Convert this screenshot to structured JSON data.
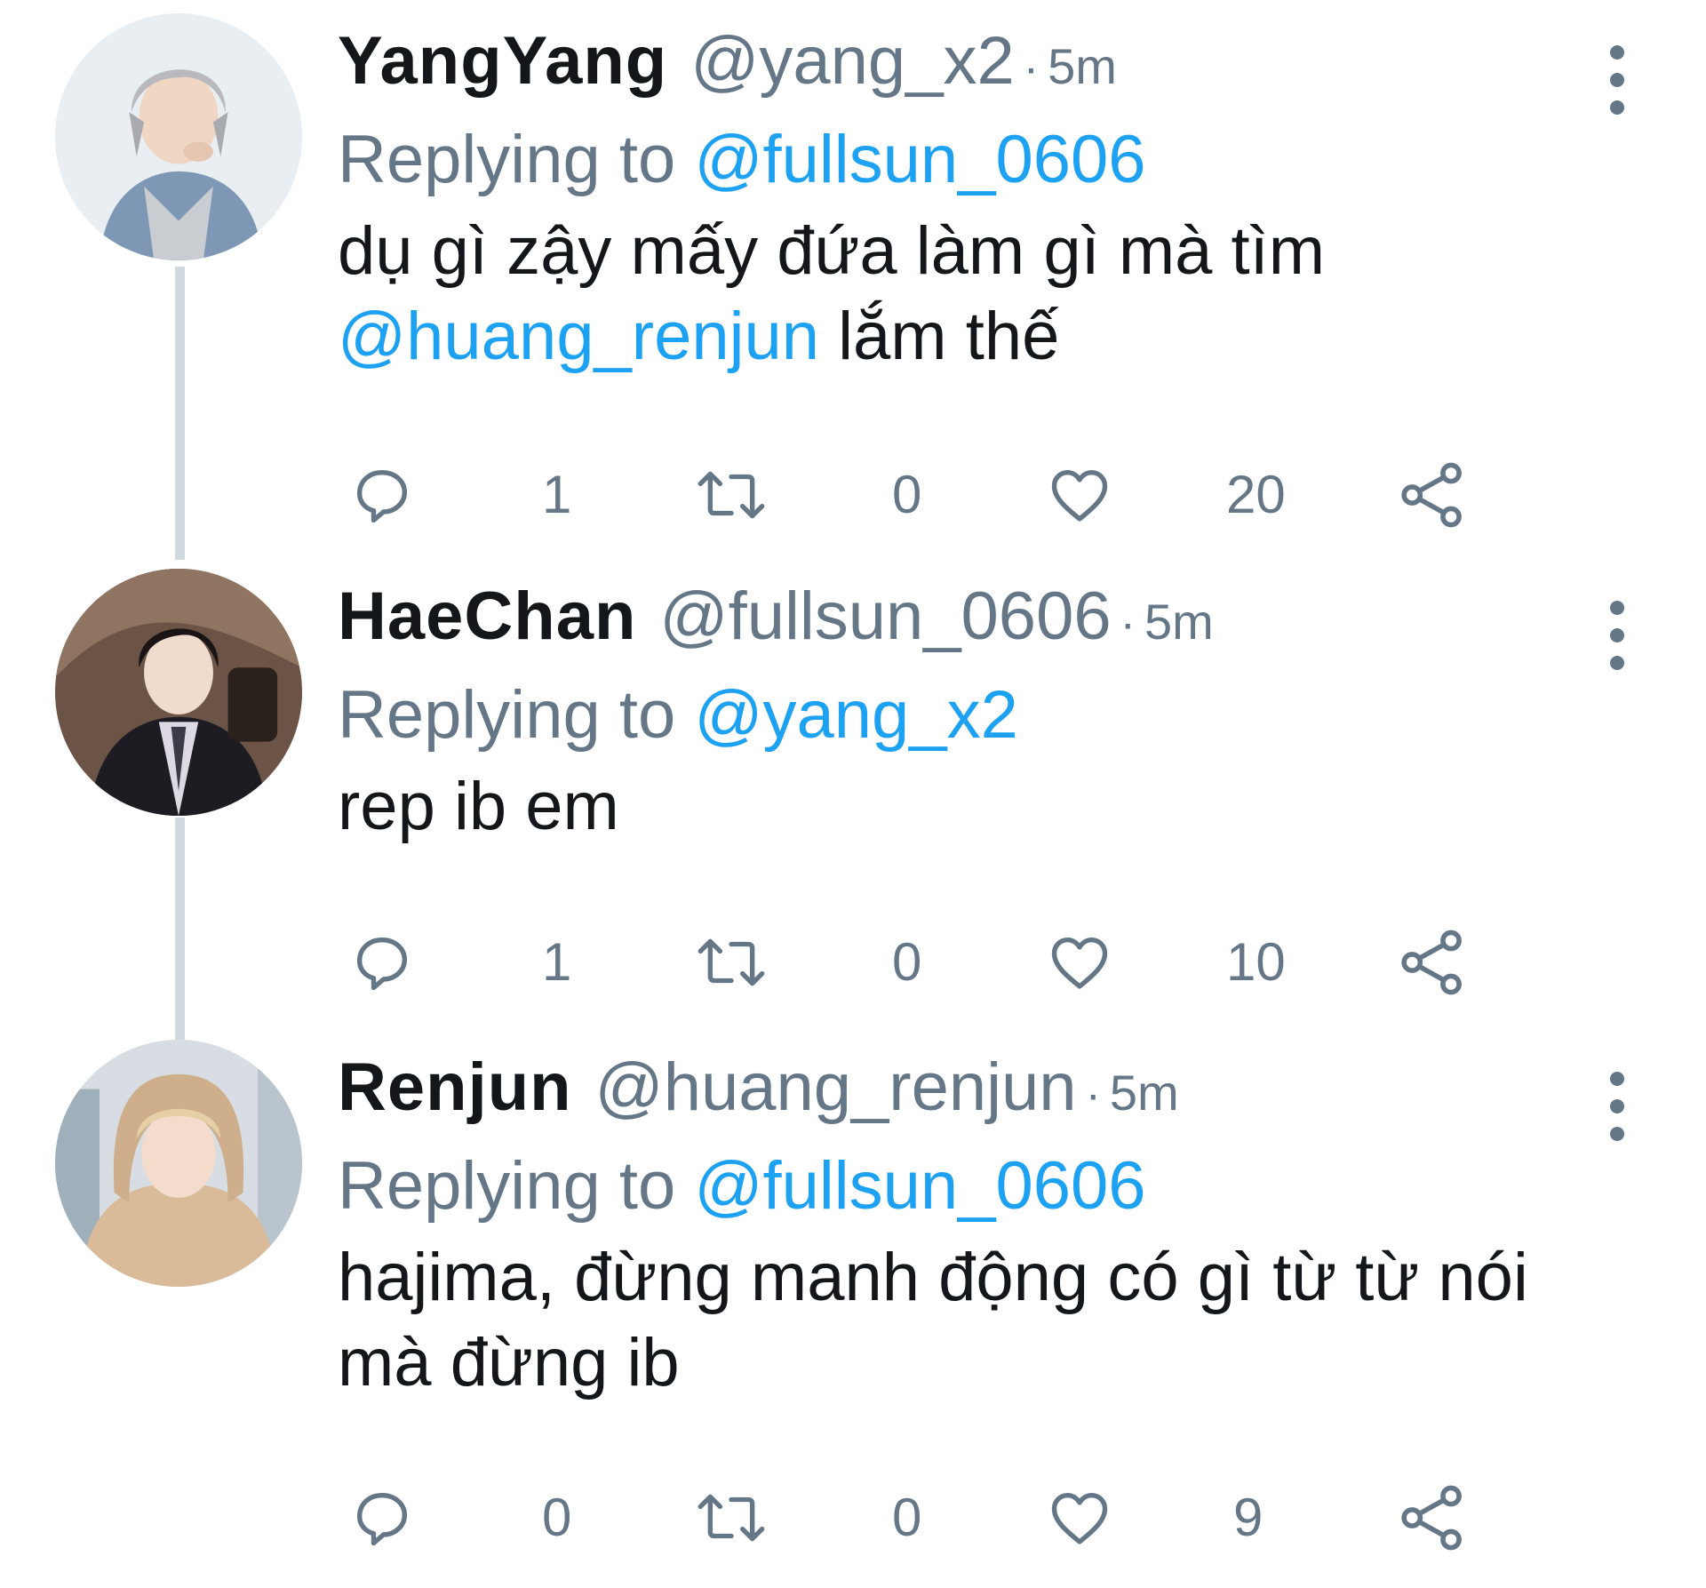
{
  "thread": {
    "tweets": [
      {
        "display_name": "YangYang",
        "handle": "@yang_x2",
        "separator": "·",
        "time": "5m",
        "replying_prefix": "Replying to ",
        "replying_to": "@fullsun_0606",
        "body_part1": "dụ gì zậy mấy đứa làm gì mà tìm ",
        "body_mention": "@huang_renjun",
        "body_part2": " lắm thế",
        "reply_count": "1",
        "retweet_count": "0",
        "like_count": "20"
      },
      {
        "display_name": "HaeChan",
        "handle": "@fullsun_0606",
        "separator": "·",
        "time": "5m",
        "replying_prefix": "Replying to ",
        "replying_to": "@yang_x2",
        "body_part1": "rep ib em",
        "body_mention": "",
        "body_part2": "",
        "reply_count": "1",
        "retweet_count": "0",
        "like_count": "10"
      },
      {
        "display_name": "Renjun",
        "handle": "@huang_renjun",
        "separator": "·",
        "time": "5m",
        "replying_prefix": "Replying to ",
        "replying_to": "@fullsun_0606",
        "body_part1": "hajima, đừng manh động có gì từ từ nói mà đừng ib",
        "body_mention": "",
        "body_part2": "",
        "reply_count": "0",
        "retweet_count": "0",
        "like_count": "9"
      }
    ]
  },
  "icons": {
    "more": "more-vertical-icon",
    "reply": "reply-bubble-icon",
    "retweet": "retweet-icon",
    "like": "heart-icon",
    "share": "share-icon"
  },
  "colors": {
    "text_primary": "#14171a",
    "text_secondary": "#657786",
    "mention": "#1da1f2",
    "thread_line": "#cfd9de"
  }
}
